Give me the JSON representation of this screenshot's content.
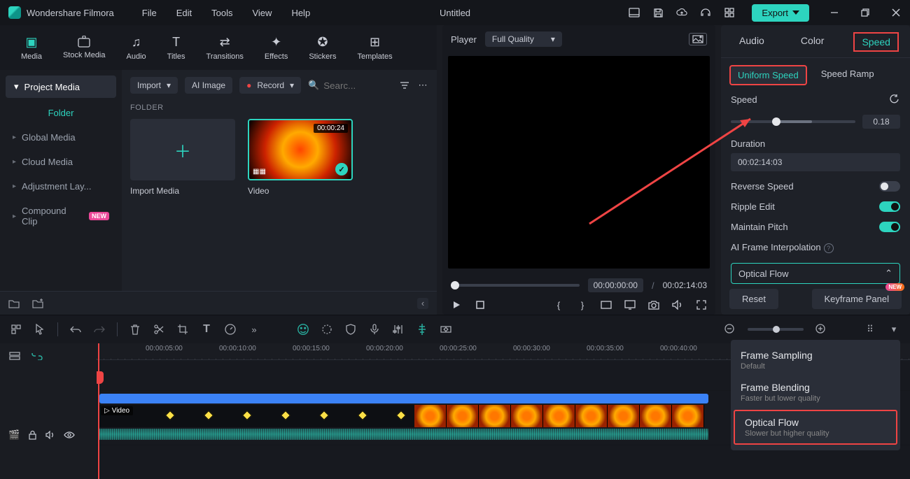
{
  "app": {
    "name": "Wondershare Filmora",
    "document": "Untitled"
  },
  "menu": [
    "File",
    "Edit",
    "Tools",
    "View",
    "Help"
  ],
  "export_label": "Export",
  "mode_tabs": [
    {
      "label": "Media",
      "active": true
    },
    {
      "label": "Stock Media"
    },
    {
      "label": "Audio"
    },
    {
      "label": "Titles"
    },
    {
      "label": "Transitions"
    },
    {
      "label": "Effects"
    },
    {
      "label": "Stickers"
    },
    {
      "label": "Templates"
    }
  ],
  "sidebar": {
    "project_media": "Project Media",
    "folder_label": "Folder",
    "items": [
      {
        "label": "Global Media"
      },
      {
        "label": "Cloud Media"
      },
      {
        "label": "Adjustment Lay..."
      },
      {
        "label": "Compound Clip",
        "badge": "NEW"
      }
    ]
  },
  "import": {
    "label": "Import",
    "ai": "AI Image",
    "record": "Record",
    "search_ph": "Searc..."
  },
  "folder_head": "FOLDER",
  "thumbs": {
    "import": "Import Media",
    "video": "Video",
    "duration": "00:00:24"
  },
  "preview": {
    "player": "Player",
    "quality": "Full Quality",
    "current": "00:00:00:00",
    "total": "00:02:14:03"
  },
  "inspector": {
    "tabs": [
      "Audio",
      "Color",
      "Speed"
    ],
    "active_tab": "Speed",
    "subtabs": [
      "Uniform Speed",
      "Speed Ramp"
    ],
    "active_sub": "Uniform Speed",
    "speed_label": "Speed",
    "speed_value": "0.18",
    "duration_label": "Duration",
    "duration_value": "00:02:14:03",
    "reverse_label": "Reverse Speed",
    "reverse_on": false,
    "ripple_label": "Ripple Edit",
    "ripple_on": true,
    "pitch_label": "Maintain Pitch",
    "pitch_on": true,
    "ai_label": "AI Frame Interpolation",
    "ai_selected": "Optical Flow",
    "ai_options": [
      {
        "title": "Frame Sampling",
        "sub": "Default"
      },
      {
        "title": "Frame Blending",
        "sub": "Faster but lower quality"
      },
      {
        "title": "Optical Flow",
        "sub": "Slower but higher quality",
        "selected": true
      }
    ],
    "reset": "Reset",
    "keyframe": "Keyframe Panel",
    "kf_badge": "NEW"
  },
  "ruler_ticks": [
    "00:00:05:00",
    "00:00:10:00",
    "00:00:15:00",
    "00:00:20:00",
    "00:00:25:00",
    "00:00:30:00",
    "00:00:35:00",
    "00:00:40:00"
  ],
  "track_clip_label": "Video"
}
